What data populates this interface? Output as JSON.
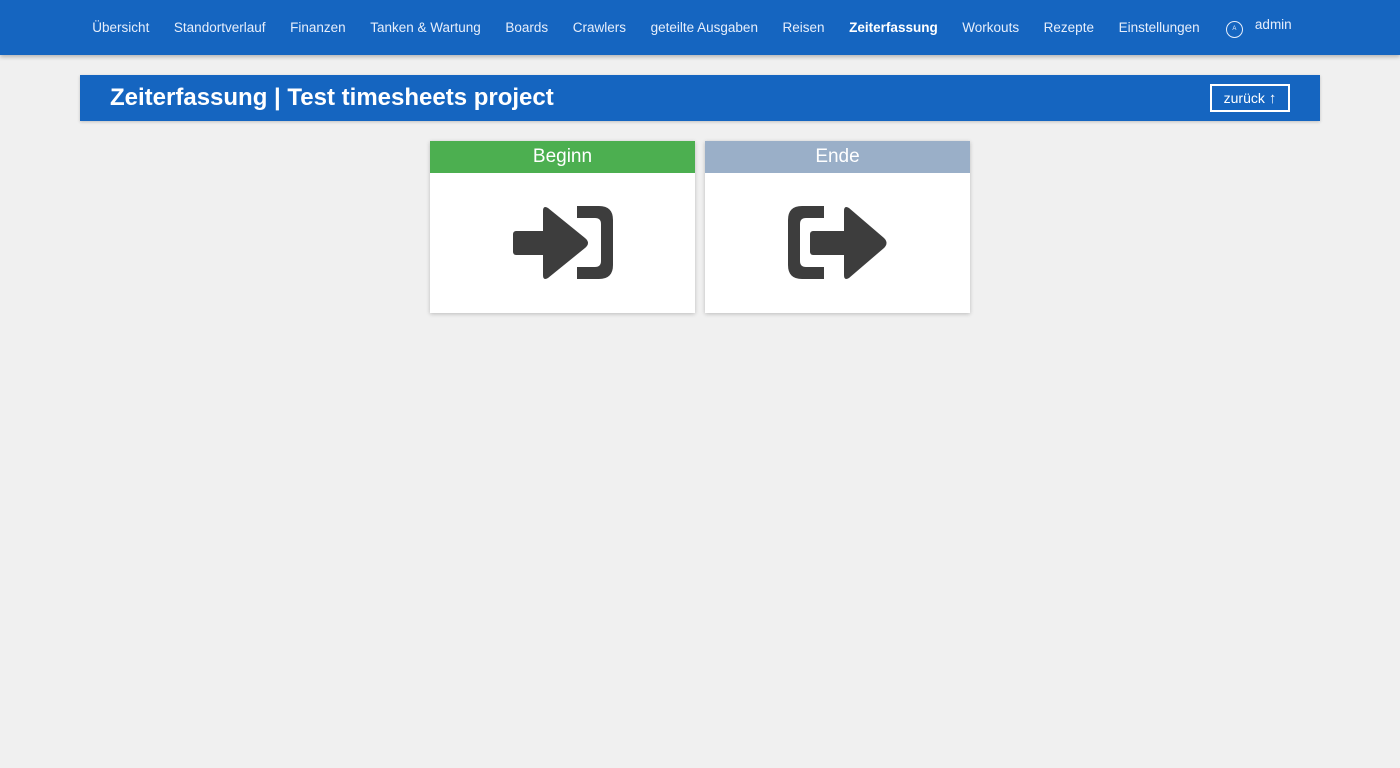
{
  "nav": {
    "items": [
      {
        "label": "Übersicht",
        "active": false
      },
      {
        "label": "Standortverlauf",
        "active": false
      },
      {
        "label": "Finanzen",
        "active": false
      },
      {
        "label": "Tanken & Wartung",
        "active": false
      },
      {
        "label": "Boards",
        "active": false
      },
      {
        "label": "Crawlers",
        "active": false
      },
      {
        "label": "geteilte Ausgaben",
        "active": false
      },
      {
        "label": "Reisen",
        "active": false
      },
      {
        "label": "Zeiterfassung",
        "active": true
      },
      {
        "label": "Workouts",
        "active": false
      },
      {
        "label": "Rezepte",
        "active": false
      },
      {
        "label": "Einstellungen",
        "active": false
      }
    ],
    "user": {
      "avatar_initial": "A",
      "name": "admin"
    }
  },
  "header": {
    "title": "Zeiterfassung | Test timesheets project",
    "back_label": "zurück",
    "back_icon": "arrow-up-icon"
  },
  "cards": {
    "start": {
      "label": "Beginn",
      "icon": "sign-in-icon",
      "color": "#4caf50"
    },
    "end": {
      "label": "Ende",
      "icon": "sign-out-icon",
      "color": "#9aafc8"
    }
  },
  "colors": {
    "primary": "#1565c0",
    "icon": "#3d3d3d",
    "background": "#f0f0f0"
  }
}
